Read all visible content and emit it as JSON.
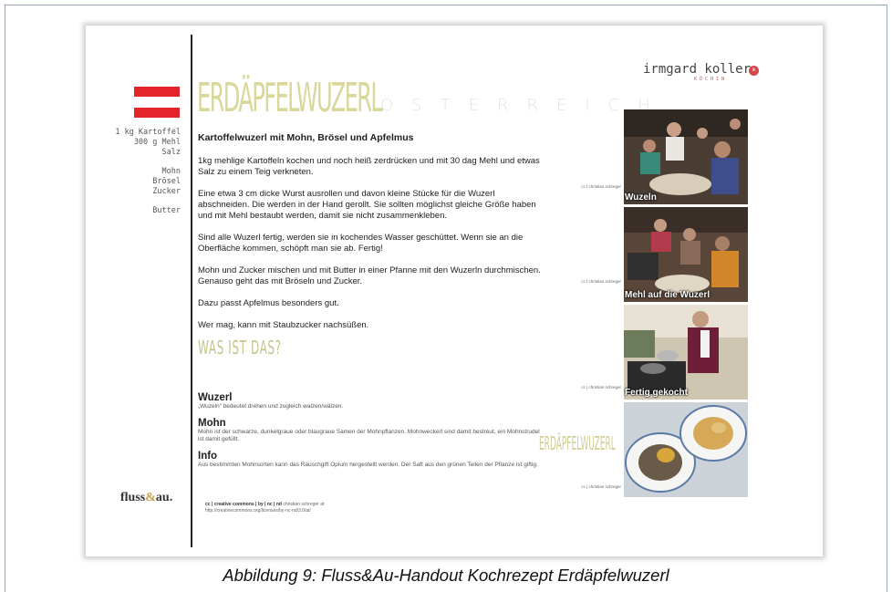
{
  "document": {
    "title": "ERDÄPFELWUZERL",
    "title_sub": "ÖSTERREICH",
    "author": "irmgard koller",
    "author_sub": "KÖCHIN",
    "author_badge": "ik",
    "flag_colors": [
      "#e3242b",
      "#ffffff",
      "#e3242b"
    ],
    "ingredients": [
      [
        "1 kg Kartoffel",
        "300 g Mehl",
        "Salz"
      ],
      [
        "Mohn",
        "Brösel",
        "Zucker"
      ],
      [
        "Butter"
      ]
    ],
    "recipe_heading": "Kartoffelwuzerl mit Mohn, Brösel und Apfelmus",
    "paragraphs": [
      "1kg mehlige Kartoffeln kochen und noch heiß zerdrücken und mit 30 dag Mehl und etwas Salz zu einem Teig verkneten.",
      "Eine etwa 3 cm dicke Wurst ausrollen und davon kleine Stücke für die Wuzerl abschneiden. Die werden in der Hand gerollt. Sie sollten möglichst gleiche Größe haben und mit Mehl bestaubt werden, damit sie nicht zusammenkleben.",
      "Sind alle Wuzerl fertig, werden sie in kochendes Wasser geschüttet. Wenn sie an die Oberfläche kommen, schöpft man sie ab. Fertig!",
      "Mohn und Zucker mischen und mit Butter in einer Pfanne mit den Wuzerln durchmischen. Genauso geht das mit Bröseln und Zucker.",
      "Dazu passt Apfelmus besonders gut.",
      "Wer mag, kann mit Staubzucker nachsüßen."
    ],
    "was_ist_das": "WAS IST DAS?",
    "definitions": [
      {
        "term": "Wuzerl",
        "text": "„Wuzeln“ bedeutet drehen und zugleich walzen/wälzen."
      },
      {
        "term": "Mohn",
        "text": "Mohn ist der schwarze, dunkelgraue oder blaugraue Samen der Mohnpflanzen. Mohnweckerl sind damit bestreut, ein Mohnstrudel ist damit gefüllt."
      },
      {
        "term": "Info",
        "text": "Aus bestimmten Mohnsorten kann das Rauschgift Opium hergestellt werden. Der Saft aus den grünen Teilen der Pflanze ist giftig."
      }
    ],
    "logo_left": "fluss",
    "logo_amp": "&",
    "logo_right": "au.",
    "license_line1": "cc | creative commons | by | nc | nd",
    "license_author": "christian schreger at",
    "license_line2": "http://creativecommons.org/licenses/by-nc-nd/3.0/at/",
    "photo_credit": "cc | christian schreger",
    "photos": [
      {
        "caption": "Wuzeln"
      },
      {
        "caption": "Mehl auf die Wuzerl"
      },
      {
        "caption": "Fertig gekocht"
      },
      {
        "caption": ""
      }
    ],
    "side_title": "ERDÄPFELWUZERL"
  },
  "figure_caption": "Abbildung 9: Fluss&Au-Handout Kochrezept Erdäpfelwuzerl"
}
